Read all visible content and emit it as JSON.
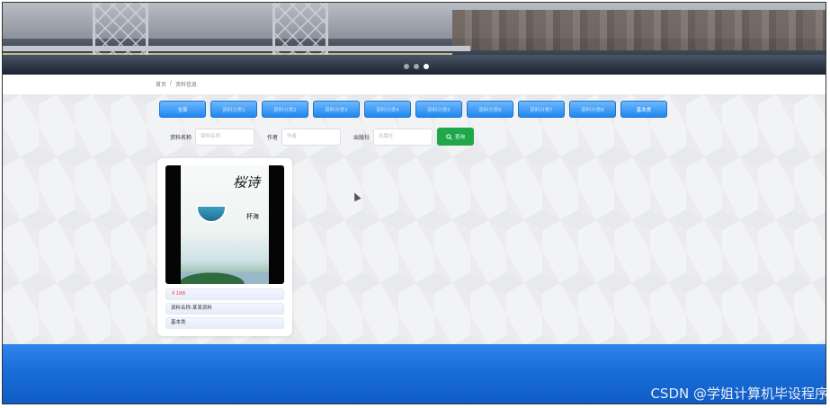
{
  "breadcrumb": {
    "home": "首页",
    "separator": "/",
    "current": "资料信息"
  },
  "tabs": [
    "全部",
    "资料分类1",
    "资料分类2",
    "资料分类3",
    "资料分类4",
    "资料分类5",
    "资料分类6",
    "资料分类7",
    "资料分类8",
    "基本类"
  ],
  "filters": {
    "name_label": "资料名称",
    "name_placeholder": "资料名称",
    "author_label": "作者",
    "author_placeholder": "作者",
    "publisher_label": "出版社",
    "publisher_placeholder": "出版社",
    "search_label": "查询"
  },
  "card": {
    "cover_title": "桜诗",
    "cover_subtitle": "杯海",
    "price": "￥188",
    "name": "资料名称:某某资料",
    "category": "基本类"
  },
  "watermark": "CSDN @学姐计算机毕设程序",
  "icons": {
    "search": "search-icon",
    "carousel": "carousel-dots"
  }
}
